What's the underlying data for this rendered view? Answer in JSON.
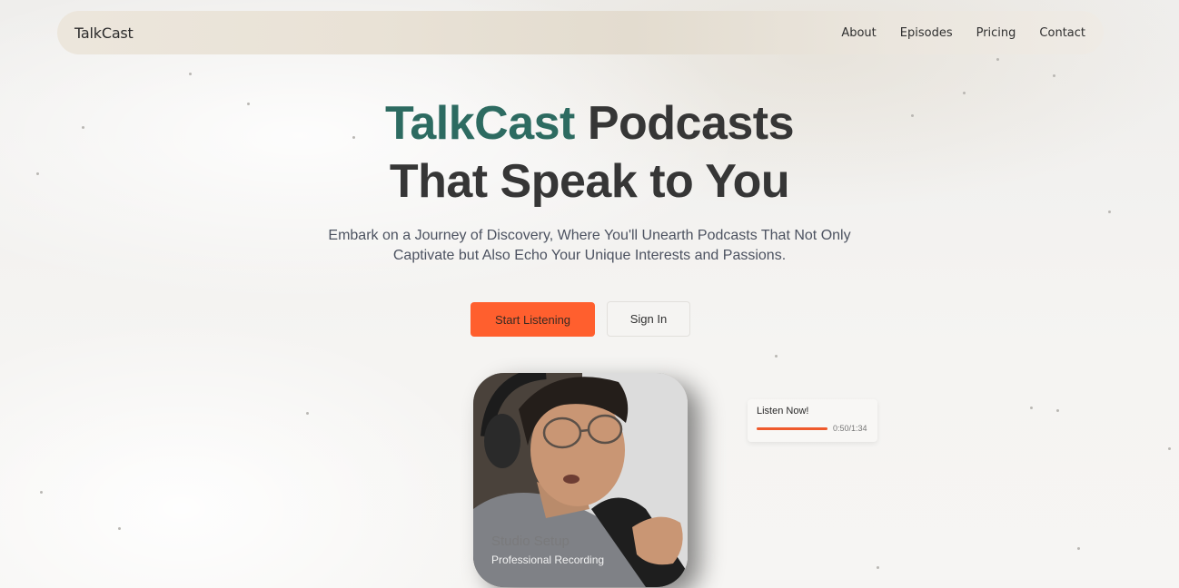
{
  "nav": {
    "brand": "TalkCast",
    "links": [
      "About",
      "Episodes",
      "Pricing",
      "Contact"
    ]
  },
  "hero": {
    "title_accent": "TalkCast",
    "title_rest": " Podcasts",
    "title_line2": "That Speak to You",
    "subtitle_line1": "Embark on a Journey of Discovery, Where You'll Unearth Podcasts That Not Only",
    "subtitle_line2": "Captivate but Also Echo Your Unique Interests and Passions.",
    "primary_button": "Start Listening",
    "secondary_button": "Sign In"
  },
  "card": {
    "title": "Studio Setup",
    "subtitle": "Professional Recording"
  },
  "player": {
    "label": "Listen Now!",
    "time": "0:50/1:34",
    "progress": 1.0
  },
  "colors": {
    "accent": "#2d6b61",
    "primary": "#ff5f2e",
    "progress": "#ef5a2c"
  }
}
